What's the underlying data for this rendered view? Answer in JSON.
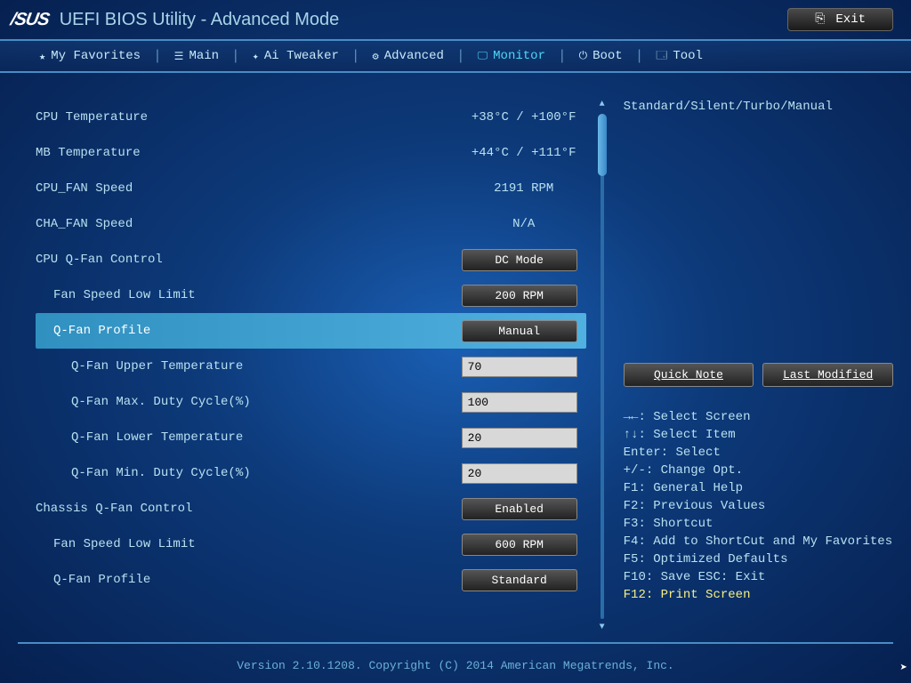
{
  "header": {
    "logo": "/SUS",
    "title": "UEFI BIOS Utility - Advanced Mode",
    "exit": "Exit"
  },
  "tabs": {
    "favorites": "My Favorites",
    "main": "Main",
    "ai_tweaker": "Ai Tweaker",
    "advanced": "Advanced",
    "monitor": "Monitor",
    "boot": "Boot",
    "tool": "Tool"
  },
  "rows": {
    "cpu_temp": {
      "label": "CPU Temperature",
      "value": "+38°C / +100°F"
    },
    "mb_temp": {
      "label": "MB Temperature",
      "value": "+44°C / +111°F"
    },
    "cpu_fan": {
      "label": "CPU_FAN Speed",
      "value": "2191 RPM"
    },
    "cha_fan": {
      "label": "CHA_FAN Speed",
      "value": "N/A"
    },
    "cpu_qfan": {
      "label": "CPU Q-Fan Control",
      "value": "DC Mode"
    },
    "fan_low1": {
      "label": "Fan Speed Low Limit",
      "value": "200 RPM"
    },
    "profile1": {
      "label": "Q-Fan Profile",
      "value": "Manual"
    },
    "upper_temp": {
      "label": "Q-Fan Upper Temperature",
      "value": "70"
    },
    "max_duty": {
      "label": "Q-Fan Max. Duty Cycle(%)",
      "value": "100"
    },
    "lower_temp": {
      "label": "Q-Fan Lower Temperature",
      "value": "20"
    },
    "min_duty": {
      "label": "Q-Fan Min. Duty Cycle(%)",
      "value": "20"
    },
    "chassis_qfan": {
      "label": "Chassis Q-Fan Control",
      "value": "Enabled"
    },
    "fan_low2": {
      "label": "Fan Speed Low Limit",
      "value": "600 RPM"
    },
    "profile2": {
      "label": "Q-Fan Profile",
      "value": "Standard"
    }
  },
  "side": {
    "help": "Standard/Silent/Turbo/Manual",
    "quick_note": "Quick Note",
    "last_modified": "Last Modified",
    "hints": {
      "h1": "→←: Select Screen",
      "h2": "↑↓: Select Item",
      "h3": "Enter: Select",
      "h4": "+/-: Change Opt.",
      "h5": "F1: General Help",
      "h6": "F2: Previous Values",
      "h7": "F3: Shortcut",
      "h8": "F4: Add to ShortCut and My Favorites",
      "h9": "F5: Optimized Defaults",
      "h10": "F10: Save  ESC: Exit",
      "h11": "F12: Print Screen"
    }
  },
  "footer": "Version 2.10.1208. Copyright (C) 2014 American Megatrends, Inc."
}
